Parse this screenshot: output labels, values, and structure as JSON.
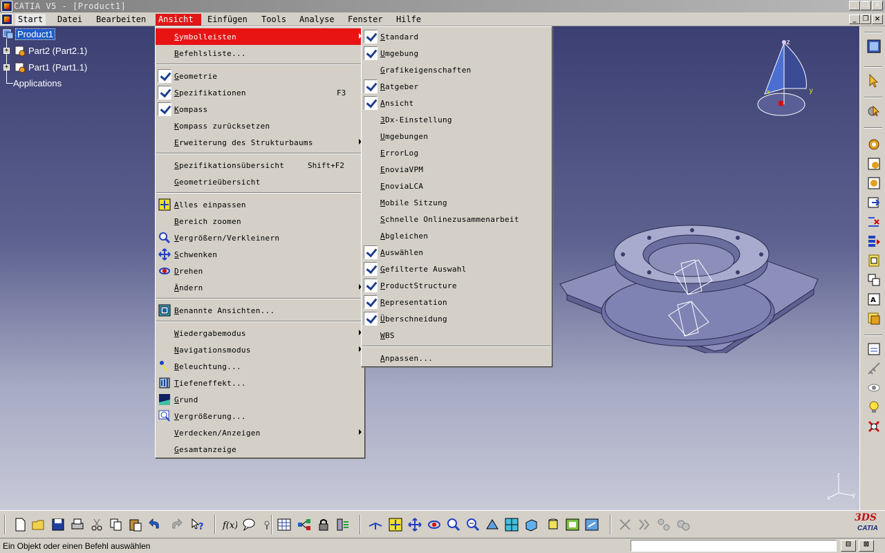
{
  "window": {
    "title": "CATIA V5 - [Product1]"
  },
  "menubar": [
    {
      "label": "Start"
    },
    {
      "label": "Datei"
    },
    {
      "label": "Bearbeiten"
    },
    {
      "label": "Ansicht"
    },
    {
      "label": "Einfügen"
    },
    {
      "label": "Tools"
    },
    {
      "label": "Analyse"
    },
    {
      "label": "Fenster"
    },
    {
      "label": "Hilfe"
    }
  ],
  "tree": {
    "root": "Product1",
    "children": [
      "Part2 (Part2.1)",
      "Part1 (Part1.1)"
    ],
    "applications": "Applications"
  },
  "ansicht_menu": {
    "items": [
      {
        "label": "Symbolleisten",
        "submenu": true,
        "highlighted": true
      },
      {
        "label": "Befehlsliste..."
      },
      {
        "label": "Geometrie",
        "checked": true
      },
      {
        "label": "Spezifikationen",
        "checked": true,
        "shortcut": "F3"
      },
      {
        "label": "Kompass",
        "checked": true
      },
      {
        "label": "Kompass zurücksetzen"
      },
      {
        "label": "Erweiterung des Strukturbaums",
        "submenu": true
      },
      {
        "label": "Spezifikationsübersicht",
        "shortcut": "Shift+F2"
      },
      {
        "label": "Geometrieübersicht"
      },
      {
        "label": "Alles einpassen",
        "icon": "fit-all-icon"
      },
      {
        "label": "Bereich zoomen"
      },
      {
        "label": "Vergrößern/Verkleinern",
        "icon": "zoom-icon"
      },
      {
        "label": "Schwenken",
        "icon": "pan-icon"
      },
      {
        "label": "Drehen",
        "icon": "rotate-icon"
      },
      {
        "label": "Ändern",
        "submenu": true
      },
      {
        "label": "Benannte Ansichten...",
        "icon": "named-views-icon"
      },
      {
        "label": "Wiedergabemodus",
        "submenu": true
      },
      {
        "label": "Navigationsmodus",
        "submenu": true
      },
      {
        "label": "Beleuchtung...",
        "icon": "lighting-icon"
      },
      {
        "label": "Tiefeneffekt...",
        "icon": "depth-effect-icon"
      },
      {
        "label": "Grund",
        "icon": "ground-icon"
      },
      {
        "label": "Vergrößerung...",
        "icon": "magnifier-icon"
      },
      {
        "label": "Verdecken/Anzeigen",
        "submenu": true
      },
      {
        "label": "Gesamtanzeige"
      }
    ]
  },
  "symbolleisten_menu": {
    "items": [
      {
        "label": "Standard",
        "checked": true
      },
      {
        "label": "Umgebung",
        "checked": true
      },
      {
        "label": "Grafikeigenschaften",
        "checked": false
      },
      {
        "label": "Ratgeber",
        "checked": true
      },
      {
        "label": "Ansicht",
        "checked": true
      },
      {
        "label": "3Dx-Einstellung",
        "checked": false
      },
      {
        "label": "Umgebungen",
        "checked": false
      },
      {
        "label": "ErrorLog",
        "checked": false
      },
      {
        "label": "EnoviaVPM",
        "checked": false
      },
      {
        "label": "EnoviaLCA",
        "checked": false
      },
      {
        "label": "Mobile Sitzung",
        "checked": false
      },
      {
        "label": "Schnelle Onlinezusammenarbeit",
        "checked": false
      },
      {
        "label": "Abgleichen",
        "checked": false
      },
      {
        "label": "Auswählen",
        "checked": true
      },
      {
        "label": "Gefilterte Auswahl",
        "checked": true
      },
      {
        "label": "ProductStructure",
        "checked": true
      },
      {
        "label": "Representation",
        "checked": true
      },
      {
        "label": "Überschneidung",
        "checked": true
      },
      {
        "label": "WBS",
        "checked": false
      },
      {
        "label": "Anpassen..."
      }
    ]
  },
  "compass": {
    "axes": [
      "x",
      "y",
      "z"
    ]
  },
  "axis_triad": {
    "axes": [
      "x",
      "y",
      "z"
    ]
  },
  "status": {
    "message": "Ein Objekt oder einen Befehl auswählen",
    "command_input": ""
  },
  "brand": {
    "logo_text": "CATIA",
    "logo_mark": "3DS"
  },
  "colors": {
    "menu_highlight": "#e81414",
    "check_color": "#1b3d8f",
    "viewport_top": "#3b3f72",
    "viewport_bottom": "#c8c9d8"
  }
}
